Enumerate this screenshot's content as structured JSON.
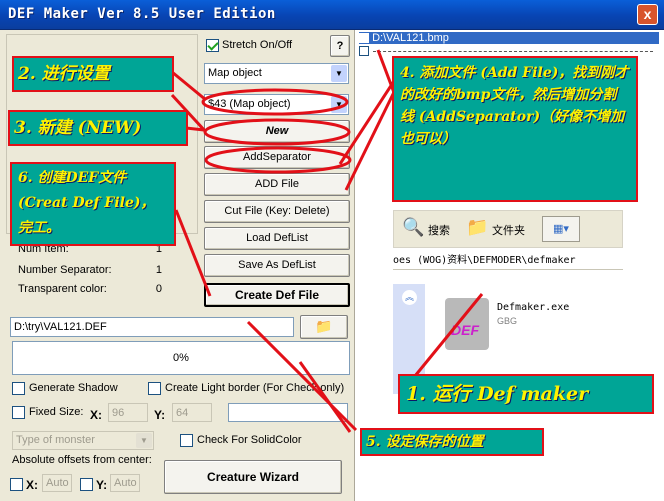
{
  "window": {
    "title": "DEF Maker Ver 8.5 User Edition",
    "close_glyph": "x"
  },
  "options": {
    "stretch_label": "Stretch On/Off",
    "stretch_checked": true,
    "help_label": "?",
    "type_combo": "Map object",
    "frame_combo": "$43 (Map object)",
    "new_label": "New"
  },
  "buttons": {
    "add_separator": "AddSeparator",
    "add_file": "ADD File",
    "cut_file": "Cut File (Key: Delete)",
    "load_deflist": "Load DefList",
    "save_deflist": "Save As DefList",
    "create_def": "Create Def File",
    "creature_wizard": "Creature Wizard"
  },
  "stats": [
    {
      "label": "Num Item:",
      "value": "1"
    },
    {
      "label": "Number Separator:",
      "value": "1"
    },
    {
      "label": "Transparent color:",
      "value": "0"
    }
  ],
  "output": {
    "path": "D:\\try\\VAL121.DEF",
    "progress_text": "0%",
    "progress": 0
  },
  "settings": {
    "generate_shadow": "Generate Shadow",
    "light_border": "Create Light border (For Check only)",
    "fixed_size": "Fixed Size:",
    "x_label": "X:",
    "y_label": "Y:",
    "fixed_x": "96",
    "fixed_y": "64",
    "monster_placeholder": "Type of monster",
    "check_solid": "Check For SolidColor",
    "abs_offsets": "Absolute offsets from center:",
    "auto_x": "Auto",
    "auto_y": "Auto"
  },
  "file_list": [
    {
      "name": "D:\\VAL121.bmp",
      "selected": true
    },
    {
      "name": "",
      "selected": false
    }
  ],
  "explorer": {
    "search_label": "搜索",
    "folder_label": "文件夹",
    "address": "oes (WOG)资料\\DEFMODER\\defmaker",
    "file_name": "Defmaker.exe",
    "file_company": "GBG",
    "icon_text": "DEF"
  },
  "annotations": {
    "step2": "2. 进行设置",
    "step3": "3. 新建 (NEW)",
    "step4": "4. 添加文件 (Add File)，找到刚才的改好的bmp文件，然后增加分割线 (AddSeparator)（好像不增加也可以）",
    "step6": "6. 创建DEF文件 (Creat Def File)，完工。",
    "step1": "1. 运行 Def maker",
    "step5": "5. 设定保存的位置"
  },
  "colors": {
    "annotation_bg": "#00a596",
    "annotation_text": "#fff200",
    "annotation_border": "#e21018",
    "titlebar": "#0a5fd8"
  }
}
